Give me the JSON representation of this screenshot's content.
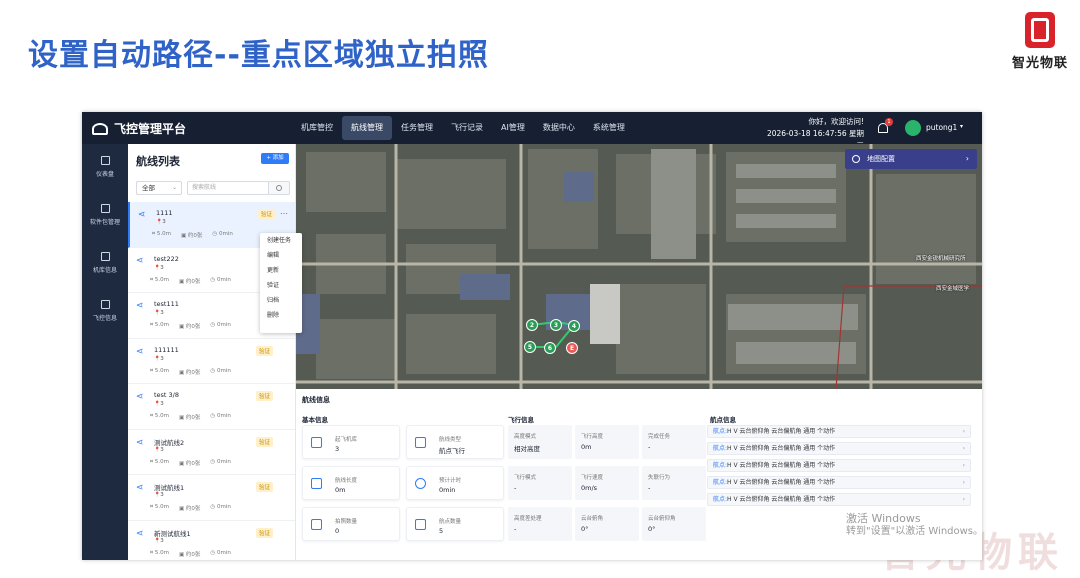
{
  "slide": {
    "title": "设置自动路径--重点区域独立拍照",
    "logo_text": "智光物联",
    "watermark": "智光物联"
  },
  "windows_watermark": {
    "line1": "激活 Windows",
    "line2": "转到\"设置\"以激活 Windows。"
  },
  "topbar": {
    "brand": "飞控管理平台",
    "nav": [
      "机库管控",
      "航线管理",
      "任务管理",
      "飞行记录",
      "AI管理",
      "数据中心",
      "系统管理"
    ],
    "active_nav": "航线管理",
    "greeting": "你好，欢迎访问!",
    "datetime": "2026-03-18 16:47:56 星期三",
    "bell_count": "1",
    "username": "putong1"
  },
  "leftnav": [
    {
      "label": "仪表盘",
      "icon": "dashboard-icon"
    },
    {
      "label": "软件包管理",
      "icon": "package-icon"
    },
    {
      "label": "机库信息",
      "icon": "hangar-icon"
    },
    {
      "label": "飞控信息",
      "icon": "flight-control-icon"
    }
  ],
  "routes_panel": {
    "title": "航线列表",
    "add_label": "+ 添加",
    "filter_value": "全部",
    "search_placeholder": "搜索航线",
    "verify_label": "验证",
    "routes": [
      {
        "name": "1111",
        "points": "3",
        "distance": "5.0m",
        "photos": "约0张",
        "time": "0min",
        "verify": true
      },
      {
        "name": "test222",
        "points": "3",
        "distance": "5.0m",
        "photos": "约0张",
        "time": "0min",
        "verify": false
      },
      {
        "name": "test111",
        "points": "3",
        "distance": "5.0m",
        "photos": "约0张",
        "time": "0min",
        "verify": false
      },
      {
        "name": "111111",
        "points": "3",
        "distance": "5.0m",
        "photos": "约0张",
        "time": "0min",
        "verify": true
      },
      {
        "name": "test 3/8",
        "points": "3",
        "distance": "5.0m",
        "photos": "约0张",
        "time": "0min",
        "verify": true
      },
      {
        "name": "测试航线2",
        "points": "3",
        "distance": "5.0m",
        "photos": "约0张",
        "time": "0min",
        "verify": true
      },
      {
        "name": "测试航线1",
        "points": "3",
        "distance": "5.0m",
        "photos": "约0张",
        "time": "0min",
        "verify": true
      },
      {
        "name": "新测试航线1",
        "points": "3",
        "distance": "5.0m",
        "photos": "约0张",
        "time": "0min",
        "verify": true
      }
    ]
  },
  "context_menu": [
    "创建任务",
    "编辑",
    "更新",
    "验证",
    "归档",
    "删除"
  ],
  "map": {
    "config_label": "地图配置",
    "labels": [
      "西安金锐机械研究所",
      "西安金域医学"
    ],
    "waypoints": [
      "2",
      "3",
      "4",
      "5",
      "6",
      "E"
    ]
  },
  "info": {
    "title": "航线信息",
    "basic_title": "基本信息",
    "basic": [
      {
        "label": "起飞机库",
        "value": "3",
        "icon": "hangar-icon"
      },
      {
        "label": "航线类型",
        "value": "航点飞行",
        "icon": "route-type-icon"
      },
      {
        "label": "航线长度",
        "value": "0m",
        "icon": "length-icon"
      },
      {
        "label": "预计计时",
        "value": "0min",
        "icon": "timer-icon"
      },
      {
        "label": "拍照数量",
        "value": "0",
        "icon": "photo-icon"
      },
      {
        "label": "航点数量",
        "value": "5",
        "icon": "waypoint-icon"
      }
    ],
    "flight_title": "飞行信息",
    "flight": [
      {
        "label": "高度模式",
        "value": "相对高度"
      },
      {
        "label": "飞行高度",
        "value": "0m"
      },
      {
        "label": "完成任务",
        "value": "-"
      },
      {
        "label": "飞行模式",
        "value": "-"
      },
      {
        "label": "飞行速度",
        "value": "0m/s"
      },
      {
        "label": "失联行为",
        "value": "-"
      },
      {
        "label": "高度差处理",
        "value": "-"
      },
      {
        "label": "云台俯角",
        "value": "0°"
      },
      {
        "label": "云台俯仰角",
        "value": "0°"
      }
    ],
    "wp_title": "航点信息",
    "wp_prefix": "航点:",
    "wp_text": "H V 云台俯仰角 云台偏航角 通用 个动作",
    "wp_count": 5
  }
}
